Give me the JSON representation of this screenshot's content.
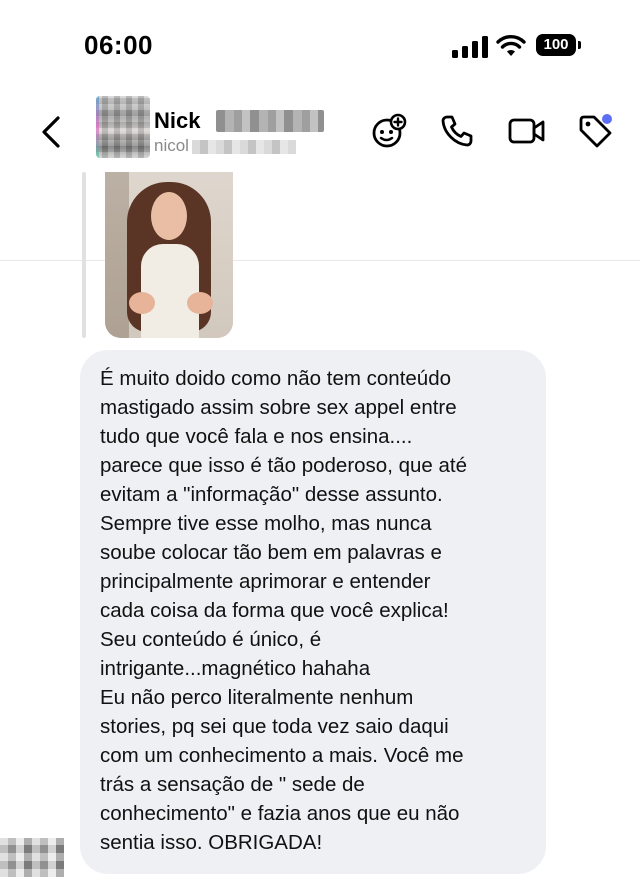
{
  "status_bar": {
    "time": "06:00",
    "battery": "100"
  },
  "header": {
    "contact_name": "Nick",
    "contact_username": "nicol",
    "icons": [
      "back-chevron-icon",
      "effects-icon",
      "phone-icon",
      "video-camera-icon",
      "tag-icon"
    ],
    "accent_dot_color": "#5b6ef5"
  },
  "conversation": {
    "reply_story": {
      "type": "story-thumbnail"
    },
    "message": {
      "bubble_color": "#eff0f3",
      "lines": [
        "É muito doido como não tem conteúdo",
        "mastigado assim sobre sex appel entre",
        "tudo que você fala e nos ensina....",
        "parece que isso é tão poderoso, que até",
        "evitam a \"informação\" desse assunto.",
        "Sempre tive esse molho, mas nunca",
        "soube colocar tão bem em palavras e",
        "principalmente aprimorar e entender",
        "cada coisa da forma que você explica!",
        "Seu conteúdo é único,  é",
        "intrigante...magnético hahaha",
        "Eu não perco literalmente nenhum",
        "stories, pq sei que toda vez saio daqui",
        "com um conhecimento a mais. Você me",
        "trás a sensação de \" sede de",
        "conhecimento\" e fazia anos que eu não",
        "sentia isso. OBRIGADA!"
      ]
    }
  }
}
